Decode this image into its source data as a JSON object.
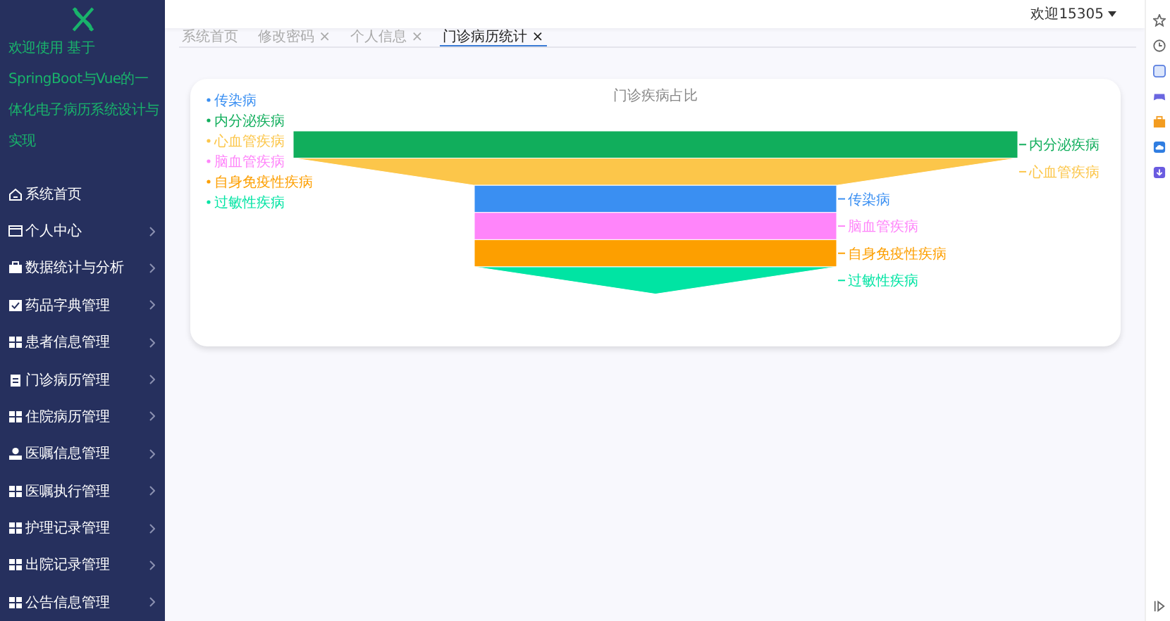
{
  "sidebar": {
    "title": "欢迎使用 基于SpringBoot与Vue的一体化电子病历系统设计与实现",
    "items": [
      {
        "label": "系统首页",
        "kind": "home",
        "expandable": false
      },
      {
        "label": "个人中心",
        "kind": "card",
        "expandable": true
      },
      {
        "label": "数据统计与分析",
        "kind": "briefcase",
        "expandable": true
      },
      {
        "label": "药品字典管理",
        "kind": "check",
        "expandable": true
      },
      {
        "label": "患者信息管理",
        "kind": "grid",
        "expandable": true
      },
      {
        "label": "门诊病历管理",
        "kind": "clipboard",
        "expandable": true
      },
      {
        "label": "住院病历管理",
        "kind": "grid",
        "expandable": true
      },
      {
        "label": "医嘱信息管理",
        "kind": "user",
        "expandable": true
      },
      {
        "label": "医嘱执行管理",
        "kind": "grid",
        "expandable": true
      },
      {
        "label": "护理记录管理",
        "kind": "grid",
        "expandable": true
      },
      {
        "label": "出院记录管理",
        "kind": "grid",
        "expandable": true
      },
      {
        "label": "公告信息管理",
        "kind": "grid",
        "expandable": true
      }
    ]
  },
  "header": {
    "user": "欢迎15305"
  },
  "tabs": [
    {
      "label": "系统首页",
      "selected": false
    },
    {
      "label": "修改密码",
      "close": "×",
      "selected": false
    },
    {
      "label": "个人信息",
      "close": "×",
      "selected": false
    },
    {
      "label": "门诊病历统计",
      "close": "×",
      "selected": true
    }
  ],
  "chart": {
    "title": "门诊疾病占比",
    "legend": [
      {
        "name": "传染病",
        "color": "#3a8ff2"
      },
      {
        "name": "内分泌疾病",
        "color": "#11ae5c"
      },
      {
        "name": "心血管疾病",
        "color": "#fcc64a"
      },
      {
        "name": "脑血管疾病",
        "color": "#ff85fa"
      },
      {
        "name": "自身免疫性疾病",
        "color": "#fd9f00"
      },
      {
        "name": "过敏性疾病",
        "color": "#00e4a3"
      }
    ],
    "segments": [
      {
        "label": "内分泌疾病",
        "color": "#11ae5c"
      },
      {
        "label": "心血管疾病",
        "color": "#fcc64a"
      },
      {
        "label": "传染病",
        "color": "#3a8ff2"
      },
      {
        "label": "脑血管疾病",
        "color": "#ff85fa"
      },
      {
        "label": "自身免疫性疾病",
        "color": "#fd9f00"
      },
      {
        "label": "过敏性疾病",
        "color": "#00e4a3"
      }
    ]
  }
}
